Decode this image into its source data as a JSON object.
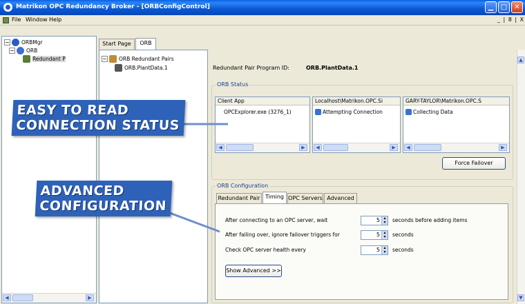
{
  "window": {
    "title": "Matrikon OPC Redundancy Broker - [ORBConfigControl]"
  },
  "menu": {
    "items": [
      "File",
      "Window",
      "Help"
    ],
    "mdi_controls": "_ | 8 | X"
  },
  "left_tree": {
    "items": [
      {
        "label": "ORBMgr",
        "expander": "−"
      },
      {
        "label": "ORB",
        "expander": "−"
      },
      {
        "label": "Redundant P"
      }
    ]
  },
  "doc_tabs": [
    "Start Page",
    "ORB"
  ],
  "mid_tree": {
    "items": [
      {
        "label": "ORB Redundant Pairs",
        "expander": "−"
      },
      {
        "label": "ORB.PlantData.1"
      }
    ]
  },
  "details": {
    "program_id_label": "Redundant Pair Program ID:",
    "program_id_value": "ORB.PlantData.1",
    "status_group": "ORB Status",
    "status_lists": [
      {
        "header": "Client App",
        "value": "OPCExplorer.exe (3276_1)"
      },
      {
        "header": "Localhost\\Matrikon.OPC.Si",
        "value": "Attempting Connection"
      },
      {
        "header": "GARY-TAYLOR\\Matrikon.OPC.S",
        "value": "Collecting Data"
      }
    ],
    "force_failover": "Force Failover",
    "config_group": "ORB Configuration",
    "config_tabs": [
      "Redundant Pair",
      "Timing",
      "OPC Servers",
      "Advanced"
    ],
    "active_config_tab": "Timing",
    "timing_rows": [
      {
        "label": "After connecting to an OPC server, wait",
        "value": "5",
        "suffix": "seconds before adding items"
      },
      {
        "label": "After failing over, ignore failover triggers for",
        "value": "5",
        "suffix": "seconds"
      },
      {
        "label": "Check OPC server health every",
        "value": "5",
        "suffix": "seconds"
      }
    ],
    "show_advanced": "Show Advanced >>"
  },
  "callouts": {
    "status": [
      "EASY TO READ",
      "CONNECTION STATUS"
    ],
    "config": [
      "ADVANCED",
      "CONFIGURATION"
    ]
  },
  "colors": {
    "titlebar": "#0a57d4",
    "callout_bg": "#2e62b8",
    "group_label": "#1c3f94"
  }
}
